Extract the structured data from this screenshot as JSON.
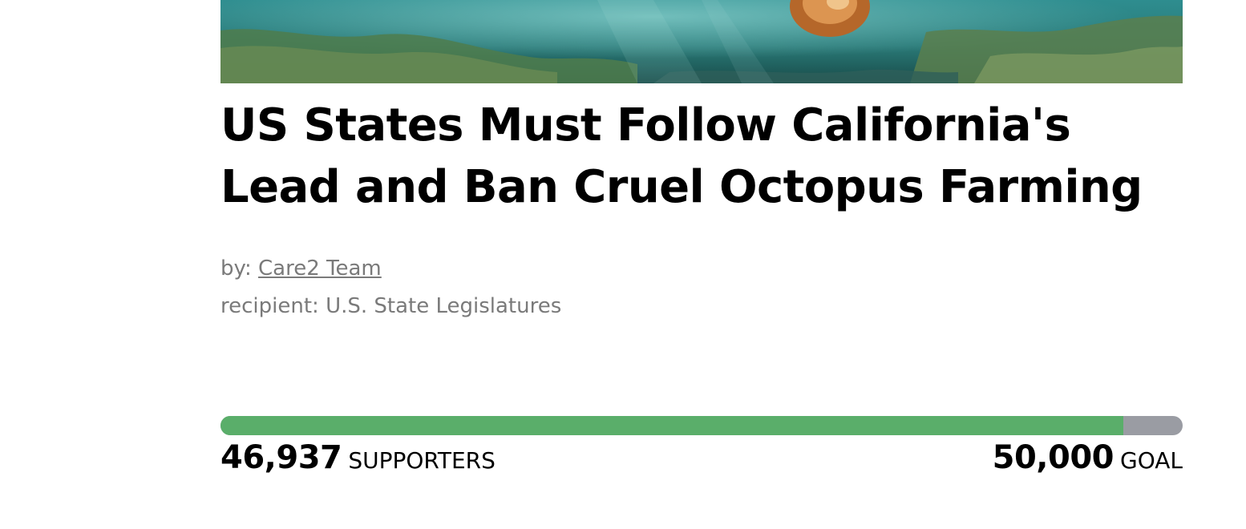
{
  "petition": {
    "title": "US States Must Follow California's Lead and Ban Cruel Octopus Farming",
    "by_label": "by:",
    "author": "Care2 Team",
    "recipient_label": "recipient:",
    "recipient": "U.S. State Legislatures"
  },
  "progress": {
    "supporters": "46,937",
    "supporters_label": "SUPPORTERS",
    "goal": "50,000",
    "goal_label": "GOAL",
    "fraction": 0.9387
  },
  "colors": {
    "progress_fill": "#5aae6a",
    "progress_track": "#9a9ca3"
  }
}
